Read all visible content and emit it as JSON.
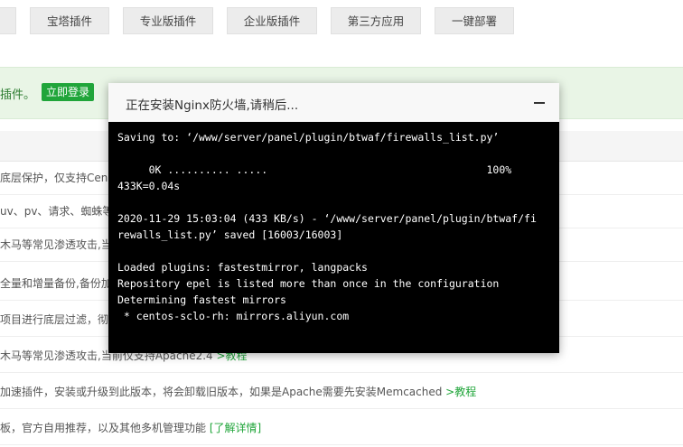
{
  "tabs": [
    {
      "label": ""
    },
    {
      "label": "宝塔插件"
    },
    {
      "label": "专业版插件"
    },
    {
      "label": "企业版插件"
    },
    {
      "label": "第三方应用"
    },
    {
      "label": "一键部署"
    }
  ],
  "notice": {
    "text": "插件。",
    "login_button": "立即登录"
  },
  "rows": [
    {
      "text": "底层保护，仅支持Cen",
      "link": ""
    },
    {
      "text": "uv、pv、请求、蜘蛛等",
      "link": ""
    },
    {
      "text": "木马等常见渗透攻击,当前",
      "link": ""
    },
    {
      "text": "全量和增量备份,备份加",
      "link": ""
    },
    {
      "text": "项目进行底层过滤，彻",
      "link": ""
    },
    {
      "text": "木马等常见渗透攻击,当前仅支持Apache2.4 ",
      "link": ">教程"
    },
    {
      "text": "加速插件，安装或升级到此版本，将会卸载旧版本，如果是Apache需要先安装Memcached ",
      "link": ">教程"
    },
    {
      "text": "板，官方自用推荐，以及其他多机管理功能 ",
      "link": "[了解详情]"
    }
  ],
  "modal": {
    "title": "正在安装Nginx防火墙,请稍后...",
    "terminal_lines": [
      "Saving to: ‘/www/server/panel/plugin/btwaf/firewalls_list.py’",
      "",
      "     0K .......... .....                                   100%",
      "433K=0.04s",
      "",
      "2020-11-29 15:03:04 (433 KB/s) - ‘/www/server/panel/plugin/btwaf/fi",
      "rewalls_list.py’ saved [16003/16003]",
      "",
      "Loaded plugins: fastestmirror, langpacks",
      "Repository epel is listed more than once in the configuration",
      "Determining fastest mirrors",
      " * centos-sclo-rh: mirrors.aliyun.com"
    ]
  },
  "colors": {
    "accent": "#20a53a",
    "notice_bg": "#e9f5e6",
    "terminal_bg": "#000000"
  }
}
